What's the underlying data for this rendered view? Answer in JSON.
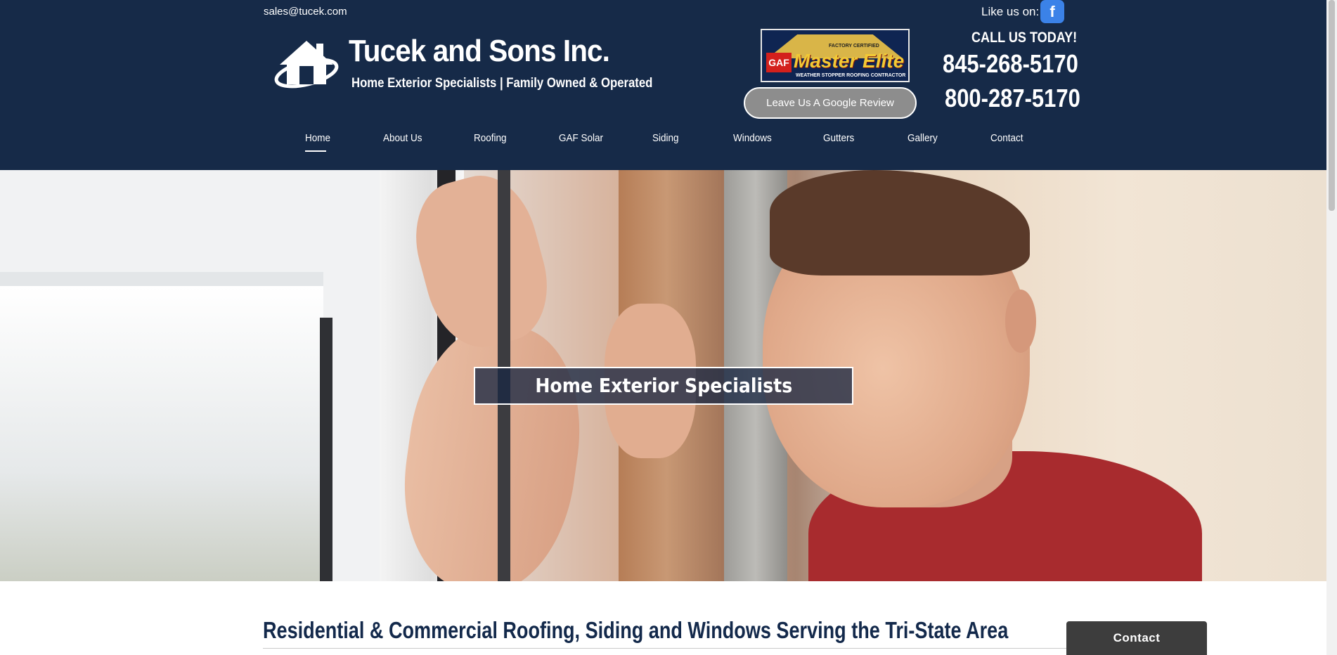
{
  "topbar": {
    "email": "sales@tucek.com",
    "like_label": "Like us on:",
    "facebook_glyph": "f",
    "facebook_icon": "facebook-icon"
  },
  "brand": {
    "name": "Tucek and Sons Inc.",
    "tagline": "Home Exterior Specialists | Family Owned & Operated",
    "logo_icon": "house-icon"
  },
  "badge": {
    "certified": "FACTORY CERTIFIED",
    "gaf": "GAF",
    "title": "Master Elite",
    "strapline": "WEATHER STOPPER ROOFING CONTRACTOR"
  },
  "review_button": "Leave Us A Google Review",
  "call": {
    "label": "CALL US TODAY!",
    "phone_1": "845-268-5170",
    "phone_2": "800-287-5170"
  },
  "nav": {
    "items": [
      {
        "label": "Home",
        "active": true
      },
      {
        "label": "About Us"
      },
      {
        "label": "Roofing"
      },
      {
        "label": "GAF Solar"
      },
      {
        "label": "Siding"
      },
      {
        "label": "Windows"
      },
      {
        "label": "Gutters"
      },
      {
        "label": "Gallery"
      },
      {
        "label": "Contact"
      }
    ]
  },
  "hero": {
    "caption": "Home Exterior Specialists"
  },
  "content": {
    "heading": "Residential & Commercial Roofing, Siding and Windows Serving the Tri-State Area"
  },
  "contact_tab": "Contact",
  "colors": {
    "header_bg": "#162a48",
    "heading": "#13294b",
    "facebook": "#3b82e8",
    "contact_tab": "#3d3d3d"
  }
}
